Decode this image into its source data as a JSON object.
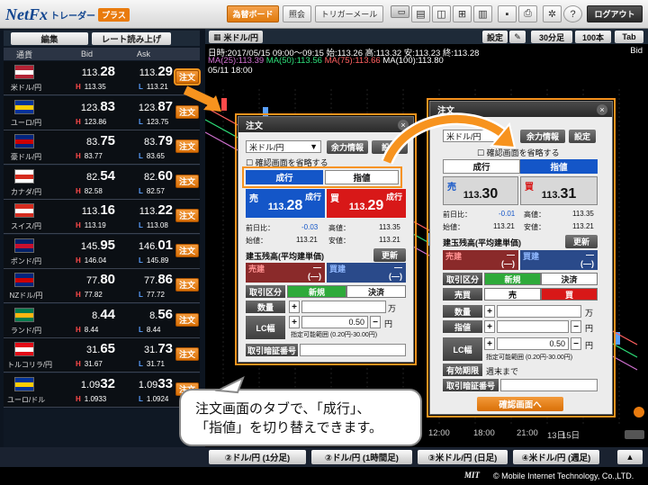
{
  "topbar": {
    "logo_brand": "NetFx",
    "logo_sub": "トレーダー",
    "logo_plus": "プラス",
    "btn_board": "為替ボード",
    "btn_inquiry": "照会",
    "btn_trigger_mail": "トリガーメール",
    "btn_logout": "ログアウト"
  },
  "rates": {
    "btn_edit": "編集",
    "btn_reading": "レート読み上げ",
    "col_pair": "通貨",
    "col_bid": "Bid",
    "col_ask": "Ask",
    "order_label": "注文",
    "high_key": "H",
    "low_key": "L",
    "rows": [
      {
        "pair": "米ドル/円",
        "bid_big": "113.",
        "bid_small": "28",
        "ask_big": "113.",
        "ask_small": "29",
        "high": "113.35",
        "low": "113.21"
      },
      {
        "pair": "ユーロ/円",
        "bid_big": "123.",
        "bid_small": "83",
        "ask_big": "123.",
        "ask_small": "87",
        "high": "123.86",
        "low": "123.75"
      },
      {
        "pair": "豪ドル/円",
        "bid_big": "83.",
        "bid_small": "75",
        "ask_big": "83.",
        "ask_small": "79",
        "high": "83.77",
        "low": "83.65"
      },
      {
        "pair": "カナダ/円",
        "bid_big": "82.",
        "bid_small": "54",
        "ask_big": "82.",
        "ask_small": "60",
        "high": "82.58",
        "low": "82.57"
      },
      {
        "pair": "スイス/円",
        "bid_big": "113.",
        "bid_small": "16",
        "ask_big": "113.",
        "ask_small": "22",
        "high": "113.19",
        "low": "113.08"
      },
      {
        "pair": "ポンド/円",
        "bid_big": "145.",
        "bid_small": "95",
        "ask_big": "146.",
        "ask_small": "01",
        "high": "146.04",
        "low": "145.89"
      },
      {
        "pair": "NZドル/円",
        "bid_big": "77.",
        "bid_small": "80",
        "ask_big": "77.",
        "ask_small": "86",
        "high": "77.82",
        "low": "77.72"
      },
      {
        "pair": "ランド/円",
        "bid_big": "8.",
        "bid_small": "44",
        "ask_big": "8.",
        "ask_small": "56",
        "high": "8.44",
        "low": "8.44"
      },
      {
        "pair": "トルコリラ/円",
        "bid_big": "31.",
        "bid_small": "65",
        "ask_big": "31.",
        "ask_small": "73",
        "high": "31.67",
        "low": "31.71"
      },
      {
        "pair": "ユーロ/ドル",
        "bid_big": "1.09",
        "bid_small": "32",
        "ask_big": "1.09",
        "ask_small": "33",
        "high": "1.0933",
        "low": "1.0924"
      }
    ]
  },
  "chart": {
    "pair_tab": "米ドル/円",
    "btn_settings": "設定",
    "btn_30min": "30分足",
    "btn_100": "100本",
    "btn_tab": "Tab",
    "info_line1": "日時:2017/05/15 09:00～09:15 始:113.26 高:113.32 安:113.23 終:113.28",
    "ma25_label": "MA(25):113.39",
    "ma50_label": "MA(50):113.56",
    "ma75_label": "MA(75):113.66",
    "ma100_label": "MA(100):113.80",
    "info_line3": "05/11 18:00",
    "bid_label": "Bid",
    "x_ticks": [
      "12:00",
      "18:00",
      "21:00",
      "13日",
      "15日"
    ]
  },
  "dialog_left": {
    "title": "注文",
    "pair": "米ドル/円",
    "btn_yoryoku": "余力情報",
    "btn_settings": "設定",
    "skip_confirm": "確認画面を省略する",
    "tab_market": "成行",
    "tab_limit": "指値",
    "sell_label": "売",
    "buy_label": "買",
    "market_label": "成行",
    "sell_big": "28",
    "sell_small": "113.",
    "buy_big": "29",
    "buy_small": "113.",
    "prev_ratio_label": "前日比：",
    "prev_ratio": "-0.03",
    "high_label": "高値：",
    "high": "113.35",
    "open_label": "始値：",
    "open": "113.21",
    "low_label": "安値：",
    "low": "113.21",
    "position_label": "建玉残高(平均建単価)",
    "btn_update": "更新",
    "sell_pos_label": "売建",
    "buy_pos_label": "買建",
    "dash": "—",
    "dash_paren": "(—)",
    "trade_type_label": "取引区分",
    "opt_new": "新規",
    "opt_settle": "決済",
    "qty_label": "数量",
    "unit_man": "万",
    "lc_label": "LC幅",
    "lc_value": "0.50",
    "unit_yen": "円",
    "lc_range": "指定可能範囲 (0.20円-30.00円)",
    "pin_label": "取引暗証番号"
  },
  "dialog_right": {
    "title": "注文",
    "pair": "米ドル/円",
    "btn_yoryoku": "余力情報",
    "btn_settings": "設定",
    "skip_confirm": "確認画面を省略する",
    "tab_market": "成行",
    "tab_limit": "指値",
    "sell_label": "売",
    "buy_label": "買",
    "sell_big": "30",
    "sell_small": "113.",
    "buy_big": "31",
    "buy_small": "113.",
    "prev_ratio_label": "前日比：",
    "prev_ratio": "-0.01",
    "high_label": "高値：",
    "high": "113.35",
    "open_label": "始値：",
    "open": "113.21",
    "low_label": "安値：",
    "low": "113.21",
    "position_label": "建玉残高(平均建単価)",
    "btn_update": "更新",
    "sell_pos_label": "売建",
    "buy_pos_label": "買建",
    "dash": "—",
    "dash_paren": "(—)",
    "trade_type_label": "取引区分",
    "opt_new": "新規",
    "opt_settle": "決済",
    "side_label": "売買",
    "opt_sell": "売",
    "opt_buy": "買",
    "qty_label": "数量",
    "unit_man": "万",
    "limit_label": "指値",
    "unit_yen": "円",
    "lc_label": "LC幅",
    "lc_value": "0.50",
    "lc_range": "指定可能範囲 (0.20円-30.00円)",
    "expiry_label": "有効期限",
    "expiry_value": "週末まで",
    "pin_label": "取引暗証番号",
    "btn_confirm": "確認画面へ"
  },
  "callout": {
    "line1": "注文画面のタブで、「成行」、",
    "line2": "「指値」を切り替えできます。"
  },
  "bottom": {
    "tab1": "②ドル/円 (1分足)",
    "tab2": "②ドル/円 (1時間足)",
    "tab3": "③米ドル/円 (日足)",
    "tab4": "④米ドル/円 (週足)"
  },
  "footer": {
    "logo": "MIT",
    "copyright": "© Mobile Internet Technology, Co.,LTD."
  },
  "colors": {
    "accent_orange": "#e97b0e",
    "sell_blue": "#1456c8",
    "buy_red": "#d81818",
    "high_red": "#ff4a4a",
    "low_blue": "#5aa0ff",
    "ma25": "#d070d0",
    "ma50": "#2ee07a",
    "ma75": "#ff6060",
    "ma100": "#ffffff"
  }
}
